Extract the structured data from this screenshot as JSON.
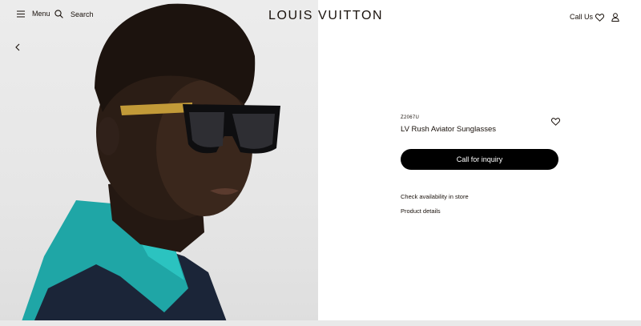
{
  "header": {
    "menu_label": "Menu",
    "search_label": "Search",
    "logo": "LOUIS VUITTON",
    "callus_label": "Call Us"
  },
  "product": {
    "sku": "Z2067U",
    "name": "LV Rush Aviator Sunglasses",
    "cta_label": "Call for inquiry",
    "availability_label": "Check availability in store",
    "details_label": "Product details"
  },
  "colors": {
    "text": "#19110b",
    "cta_bg": "#000000",
    "photo_bg": "#e8e8e8",
    "shirt_teal": "#1fa6a6",
    "jacket_navy": "#1b2538"
  },
  "icons": [
    "menu-icon",
    "search-icon",
    "heart-icon",
    "account-icon",
    "chevron-left-icon"
  ]
}
